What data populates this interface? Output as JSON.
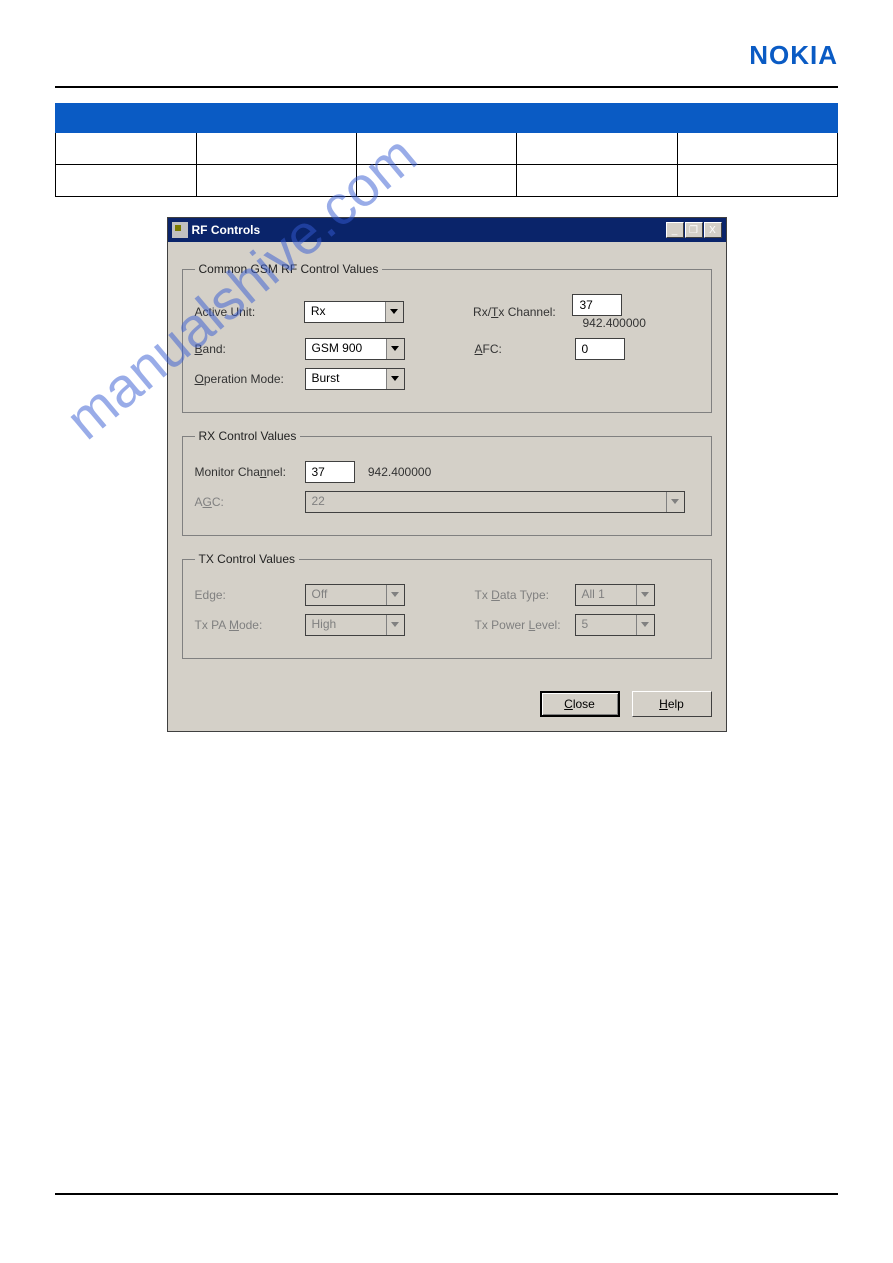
{
  "brand": {
    "logo_text": "NOKIA"
  },
  "table": {
    "headers": [
      "",
      "",
      "",
      "",
      ""
    ],
    "rows": [
      [
        " ",
        " ",
        " ",
        " ",
        " "
      ],
      [
        " ",
        " ",
        " ",
        " ",
        " "
      ]
    ]
  },
  "dialog": {
    "title": "RF Controls",
    "win_btns": {
      "min": "_",
      "restore": "❐",
      "close": "X"
    },
    "group1": {
      "legend": "Common GSM RF Control Values",
      "active_unit_label": "Active Unit:",
      "active_unit_value": "Rx",
      "band_label_plain": "and:",
      "band_ul": "B",
      "band_value": "GSM 900",
      "op_label_plain": "peration Mode:",
      "op_ul": "O",
      "op_value": "Burst",
      "rxtx_label_pre": "Rx/",
      "rxtx_ul": "T",
      "rxtx_label_post": "x Channel:",
      "rxtx_value": "37",
      "rxtx_freq": "942.400000",
      "afc_ul": "A",
      "afc_label_post": "FC:",
      "afc_value": "0"
    },
    "group2": {
      "legend": "RX Control Values",
      "mon_label_pre": "Monitor Cha",
      "mon_ul": "n",
      "mon_label_post": "nel:",
      "mon_value": "37",
      "mon_freq": "942.400000",
      "agc_label_pre": "A",
      "agc_ul": "G",
      "agc_label_post": "C:",
      "agc_value": "22"
    },
    "group3": {
      "legend": "TX Control Values",
      "edge_label_pre": "Ed",
      "edge_ul": "g",
      "edge_label_post": "e:",
      "edge_value": "Off",
      "txpa_label_pre": "Tx PA ",
      "txpa_ul": "M",
      "txpa_label_post": "ode:",
      "txpa_value": "High",
      "txdata_label_pre": "Tx ",
      "txdata_ul": "D",
      "txdata_label_post": "ata Type:",
      "txdata_value": "All 1",
      "txpwr_label_pre": "Tx Power ",
      "txpwr_ul": "L",
      "txpwr_label_post": "evel:",
      "txpwr_value": "5"
    },
    "buttons": {
      "close_ul": "C",
      "close_post": "lose",
      "help_ul": "H",
      "help_post": "elp"
    }
  },
  "watermark": "manualshive.com"
}
